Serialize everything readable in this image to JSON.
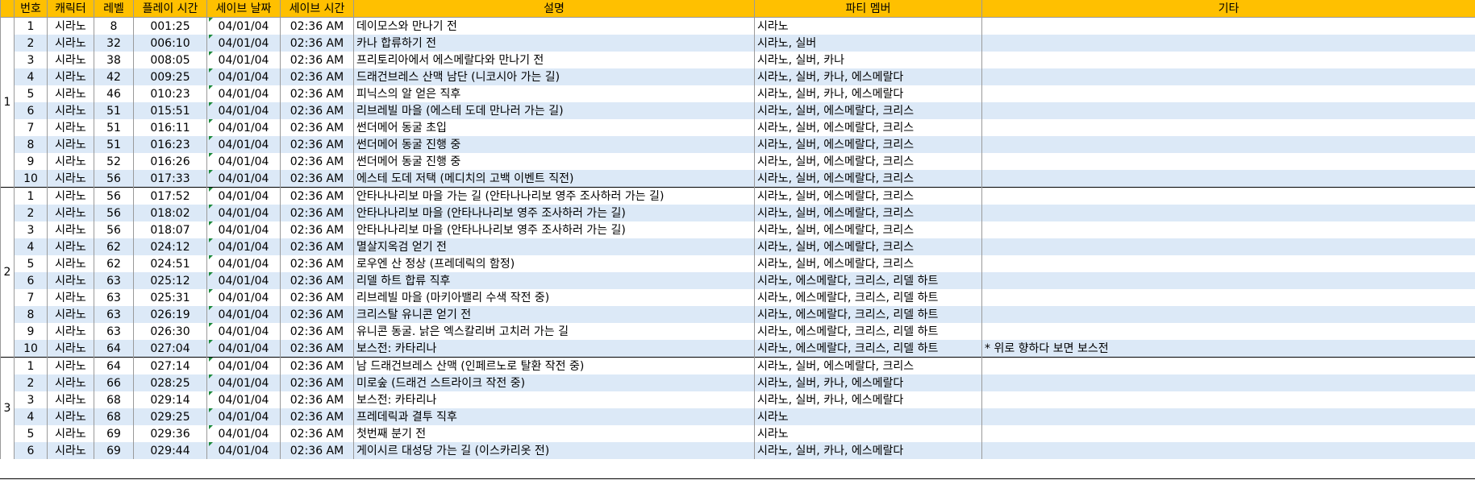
{
  "headers": [
    "번호",
    "캐릭터",
    "레벨",
    "플레이 시간",
    "세이브 날짜",
    "세이브 시간",
    "설명",
    "파티 멤버",
    "기타"
  ],
  "groups": [
    {
      "label": "1",
      "rows": [
        {
          "no": "1",
          "char": "시라노",
          "lv": "8",
          "time": "001:25",
          "date": "04/01/04",
          "stime": "02:36 AM",
          "desc": "데이모스와 만나기 전",
          "party": "시라노",
          "etc": ""
        },
        {
          "no": "2",
          "char": "시라노",
          "lv": "32",
          "time": "006:10",
          "date": "04/01/04",
          "stime": "02:36 AM",
          "desc": "카나 합류하기 전",
          "party": "시라노, 실버",
          "etc": ""
        },
        {
          "no": "3",
          "char": "시라노",
          "lv": "38",
          "time": "008:05",
          "date": "04/01/04",
          "stime": "02:36 AM",
          "desc": "프리토리아에서 에스메랄다와 만나기 전",
          "party": "시라노, 실버, 카나",
          "etc": ""
        },
        {
          "no": "4",
          "char": "시라노",
          "lv": "42",
          "time": "009:25",
          "date": "04/01/04",
          "stime": "02:36 AM",
          "desc": "드래건브레스 산맥 남단 (니코시아 가는 길)",
          "party": "시라노, 실버, 카나, 에스메랄다",
          "etc": ""
        },
        {
          "no": "5",
          "char": "시라노",
          "lv": "46",
          "time": "010:23",
          "date": "04/01/04",
          "stime": "02:36 AM",
          "desc": "피닉스의 알 얻은 직후",
          "party": "시라노, 실버, 카나, 에스메랄다",
          "etc": ""
        },
        {
          "no": "6",
          "char": "시라노",
          "lv": "51",
          "time": "015:51",
          "date": "04/01/04",
          "stime": "02:36 AM",
          "desc": "리브레빌 마을 (에스테 도데 만나러 가는 길)",
          "party": "시라노, 실버, 에스메랄다, 크리스",
          "etc": ""
        },
        {
          "no": "7",
          "char": "시라노",
          "lv": "51",
          "time": "016:11",
          "date": "04/01/04",
          "stime": "02:36 AM",
          "desc": "썬더메어 동굴 초입",
          "party": "시라노, 실버, 에스메랄다, 크리스",
          "etc": ""
        },
        {
          "no": "8",
          "char": "시라노",
          "lv": "51",
          "time": "016:23",
          "date": "04/01/04",
          "stime": "02:36 AM",
          "desc": "썬더메어 동굴 진행 중",
          "party": "시라노, 실버, 에스메랄다, 크리스",
          "etc": ""
        },
        {
          "no": "9",
          "char": "시라노",
          "lv": "52",
          "time": "016:26",
          "date": "04/01/04",
          "stime": "02:36 AM",
          "desc": "썬더메어 동굴 진행 중",
          "party": "시라노, 실버, 에스메랄다, 크리스",
          "etc": ""
        },
        {
          "no": "10",
          "char": "시라노",
          "lv": "56",
          "time": "017:33",
          "date": "04/01/04",
          "stime": "02:36 AM",
          "desc": "에스테 도데 저택 (메디치의 고백 이벤트 직전)",
          "party": "시라노, 실버, 에스메랄다, 크리스",
          "etc": ""
        }
      ]
    },
    {
      "label": "2",
      "rows": [
        {
          "no": "1",
          "char": "시라노",
          "lv": "56",
          "time": "017:52",
          "date": "04/01/04",
          "stime": "02:36 AM",
          "desc": "안타나나리보 마을 가는 길 (안타나나리보 영주 조사하러 가는 길)",
          "party": "시라노, 실버, 에스메랄다, 크리스",
          "etc": ""
        },
        {
          "no": "2",
          "char": "시라노",
          "lv": "56",
          "time": "018:02",
          "date": "04/01/04",
          "stime": "02:36 AM",
          "desc": "안타나나리보 마을 (안타나나리보 영주 조사하러 가는 길)",
          "party": "시라노, 실버, 에스메랄다, 크리스",
          "etc": ""
        },
        {
          "no": "3",
          "char": "시라노",
          "lv": "56",
          "time": "018:07",
          "date": "04/01/04",
          "stime": "02:36 AM",
          "desc": "안타나나리보 마을 (안타나나리보 영주 조사하러 가는 길)",
          "party": "시라노, 실버, 에스메랄다, 크리스",
          "etc": ""
        },
        {
          "no": "4",
          "char": "시라노",
          "lv": "62",
          "time": "024:12",
          "date": "04/01/04",
          "stime": "02:36 AM",
          "desc": "멸살지옥검 얻기 전",
          "party": "시라노, 실버, 에스메랄다, 크리스",
          "etc": ""
        },
        {
          "no": "5",
          "char": "시라노",
          "lv": "62",
          "time": "024:51",
          "date": "04/01/04",
          "stime": "02:36 AM",
          "desc": "로우엔 산 정상 (프레데릭의 함정)",
          "party": "시라노, 실버, 에스메랄다, 크리스",
          "etc": ""
        },
        {
          "no": "6",
          "char": "시라노",
          "lv": "63",
          "time": "025:12",
          "date": "04/01/04",
          "stime": "02:36 AM",
          "desc": "리델 하트 합류 직후",
          "party": "시라노, 에스메랄다, 크리스, 리델 하트",
          "etc": ""
        },
        {
          "no": "7",
          "char": "시라노",
          "lv": "63",
          "time": "025:31",
          "date": "04/01/04",
          "stime": "02:36 AM",
          "desc": "리브레빌 마을 (마키아밸리 수색 작전 중)",
          "party": "시라노, 에스메랄다, 크리스, 리델 하트",
          "etc": ""
        },
        {
          "no": "8",
          "char": "시라노",
          "lv": "63",
          "time": "026:19",
          "date": "04/01/04",
          "stime": "02:36 AM",
          "desc": "크리스탈 유니콘 얻기 전",
          "party": "시라노, 에스메랄다, 크리스, 리델 하트",
          "etc": ""
        },
        {
          "no": "9",
          "char": "시라노",
          "lv": "63",
          "time": "026:30",
          "date": "04/01/04",
          "stime": "02:36 AM",
          "desc": "유니콘 동굴. 낡은 엑스칼리버 고치러 가는 길",
          "party": "시라노, 에스메랄다, 크리스, 리델 하트",
          "etc": ""
        },
        {
          "no": "10",
          "char": "시라노",
          "lv": "64",
          "time": "027:04",
          "date": "04/01/04",
          "stime": "02:36 AM",
          "desc": "보스전: 카타리나",
          "party": "시라노, 에스메랄다, 크리스, 리델 하트",
          "etc": "* 위로 향하다 보면 보스전"
        }
      ]
    },
    {
      "label": "3",
      "rows": [
        {
          "no": "1",
          "char": "시라노",
          "lv": "64",
          "time": "027:14",
          "date": "04/01/04",
          "stime": "02:36 AM",
          "desc": "남 드래건브레스 산맥 (인페르노로 탈환 작전 중)",
          "party": "시라노, 실버, 에스메랄다, 크리스",
          "etc": ""
        },
        {
          "no": "2",
          "char": "시라노",
          "lv": "66",
          "time": "028:25",
          "date": "04/01/04",
          "stime": "02:36 AM",
          "desc": "미로숲 (드래건 스트라이크 작전 중)",
          "party": "시라노, 실버, 카나, 에스메랄다",
          "etc": ""
        },
        {
          "no": "3",
          "char": "시라노",
          "lv": "68",
          "time": "029:14",
          "date": "04/01/04",
          "stime": "02:36 AM",
          "desc": "보스전: 카타리나",
          "party": "시라노, 실버, 카나, 에스메랄다",
          "etc": ""
        },
        {
          "no": "4",
          "char": "시라노",
          "lv": "68",
          "time": "029:25",
          "date": "04/01/04",
          "stime": "02:36 AM",
          "desc": "프레데릭과 결투 직후",
          "party": "시라노",
          "etc": ""
        },
        {
          "no": "5",
          "char": "시라노",
          "lv": "69",
          "time": "029:36",
          "date": "04/01/04",
          "stime": "02:36 AM",
          "desc": "첫번째 분기 전",
          "party": "시라노",
          "etc": ""
        },
        {
          "no": "6",
          "char": "시라노",
          "lv": "69",
          "time": "029:44",
          "date": "04/01/04",
          "stime": "02:36 AM",
          "desc": "게이시르 대성당 가는 길 (이스카리옷 전)",
          "party": "시라노, 실버, 카나, 에스메랄다",
          "etc": ""
        }
      ]
    }
  ]
}
